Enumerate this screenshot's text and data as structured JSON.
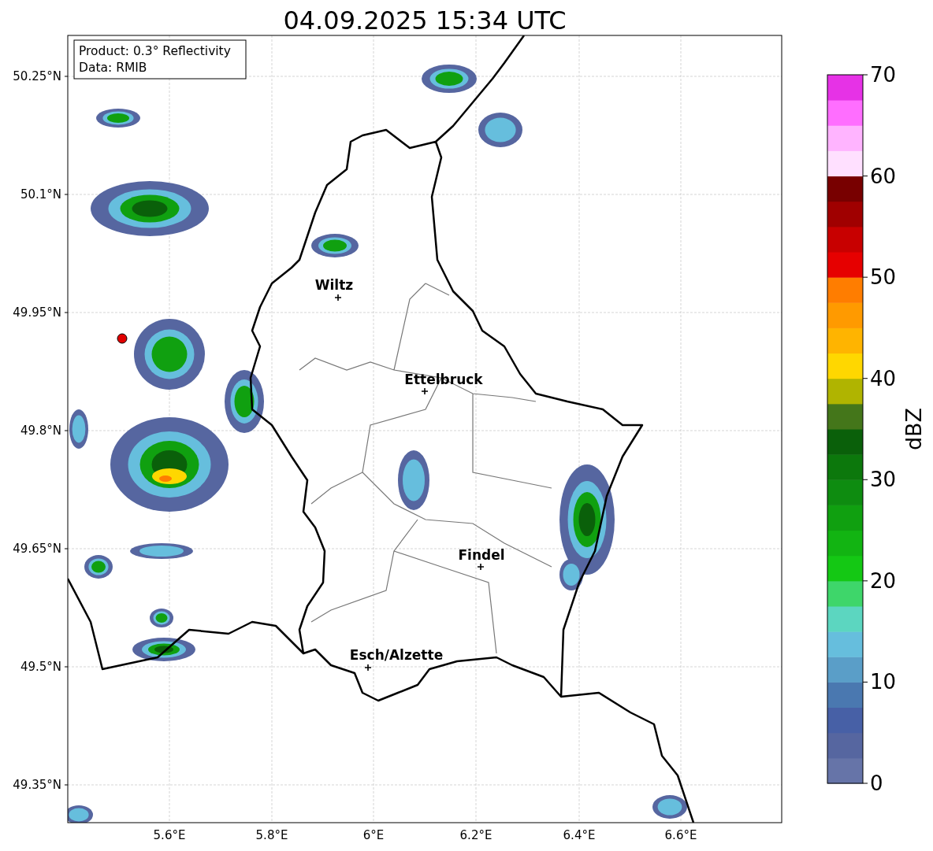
{
  "title": "04.09.2025 15:34 UTC",
  "info_box": [
    "Product: 0.3° Reflectivity",
    "Data: RMIB"
  ],
  "latitude_labels": [
    "50.25°N",
    "50.1°N",
    "49.95°N",
    "49.8°N",
    "49.65°N",
    "49.5°N",
    "49.35°N"
  ],
  "longitude_labels": [
    "5.6°E",
    "5.8°E",
    "6°E",
    "6.2°E",
    "6.4°E",
    "6.6°E"
  ],
  "places": [
    {
      "name": "Wiltz"
    },
    {
      "name": "Ettelbruck"
    },
    {
      "name": "Findel"
    },
    {
      "name": "Esch/Alzette"
    }
  ],
  "colorbar": {
    "label": "dBZ",
    "ticks": [
      "70",
      "60",
      "50",
      "40",
      "30",
      "20",
      "10",
      "0"
    ],
    "bins": [
      {
        "color": "#6674a8"
      },
      {
        "color": "#5666a0"
      },
      {
        "color": "#4760a6"
      },
      {
        "color": "#4a78b0"
      },
      {
        "color": "#5a9ec8"
      },
      {
        "color": "#66bedd"
      },
      {
        "color": "#5cd6c0"
      },
      {
        "color": "#3ed66a"
      },
      {
        "color": "#14c814"
      },
      {
        "color": "#12b412"
      },
      {
        "color": "#10a010"
      },
      {
        "color": "#0e8c10"
      },
      {
        "color": "#0c780c"
      },
      {
        "color": "#0a600a"
      },
      {
        "color": "#44761a"
      },
      {
        "color": "#b0b400"
      },
      {
        "color": "#ffd700"
      },
      {
        "color": "#ffb400"
      },
      {
        "color": "#ff9a00"
      },
      {
        "color": "#ff7d00"
      },
      {
        "color": "#e60000"
      },
      {
        "color": "#c80000"
      },
      {
        "color": "#a00000"
      },
      {
        "color": "#780000"
      },
      {
        "color": "#ffe0ff"
      },
      {
        "color": "#ffb4ff"
      },
      {
        "color": "#ff6eff"
      },
      {
        "color": "#e632e6"
      }
    ]
  }
}
